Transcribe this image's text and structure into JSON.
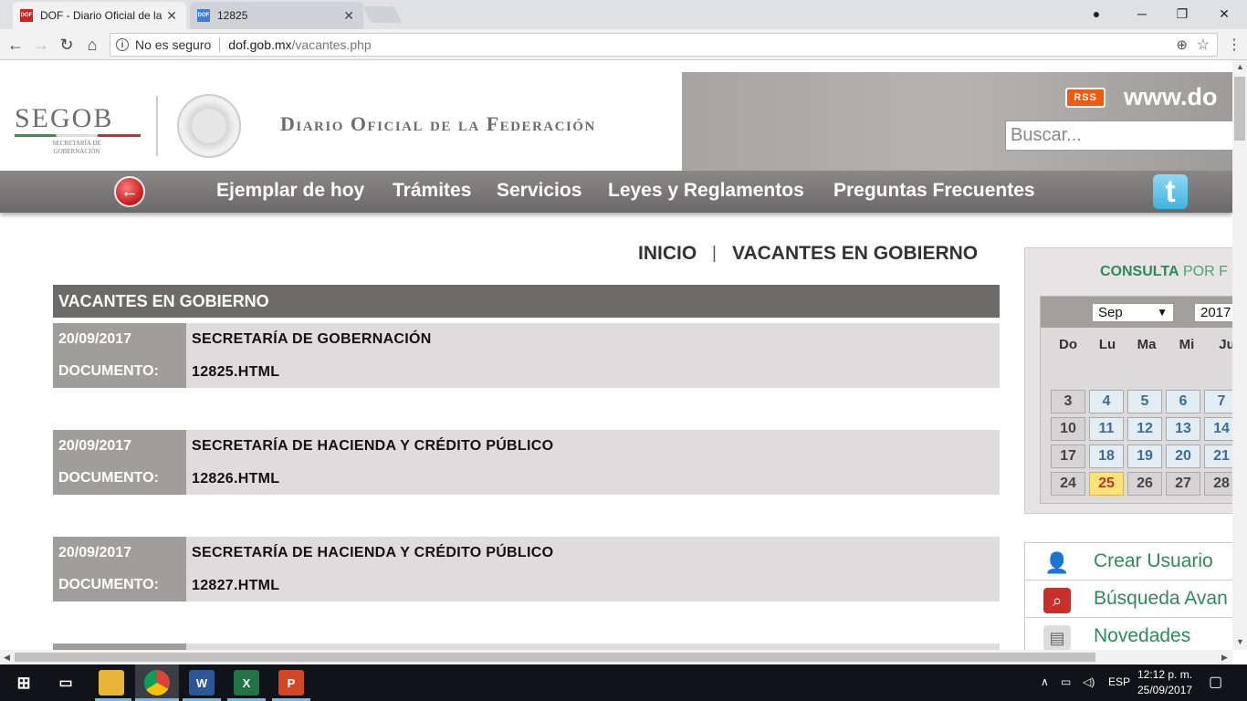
{
  "browser": {
    "tabs": [
      {
        "title": "DOF - Diario Oficial de la",
        "favicon": "DOF",
        "active": true
      },
      {
        "title": "12825",
        "favicon": "DOF",
        "active": false
      }
    ],
    "security_label": "No es seguro",
    "url_host": "dof.gob.mx",
    "url_path": "/vacantes.php"
  },
  "header": {
    "logo_text": "SEGOB",
    "logo_sub": "SECRETARÍA DE GOBERNACIÓN",
    "title": "Diario Oficial de la Federación",
    "rss_label": "RSS",
    "www_text": "www.do",
    "search_placeholder": "Buscar..."
  },
  "nav": {
    "items": [
      "Ejemplar de hoy",
      "Trámites",
      "Servicios",
      "Leyes y Reglamentos",
      "Preguntas Frecuentes"
    ]
  },
  "breadcrumb": {
    "home": "INICIO",
    "separator": "|",
    "current": "VACANTES EN GOBIERNO"
  },
  "list": {
    "header": "VACANTES EN GOBIERNO",
    "doc_label": "DOCUMENTO:",
    "items": [
      {
        "date": "20/09/2017",
        "agency": "SECRETARÍA DE GOBERNACIÓN",
        "document": "12825.HTML"
      },
      {
        "date": "20/09/2017",
        "agency": "SECRETARÍA DE HACIENDA Y CRÉDITO PÚBLICO",
        "document": "12826.HTML"
      },
      {
        "date": "20/09/2017",
        "agency": "SECRETARÍA DE HACIENDA Y CRÉDITO PÚBLICO",
        "document": "12827.HTML"
      }
    ]
  },
  "sidebar": {
    "consulta_bold": "CONSULTA",
    "consulta_rest": "POR F",
    "calendar": {
      "month": "Sep",
      "year": "2017",
      "dow": [
        "Do",
        "Lu",
        "Ma",
        "Mi",
        "Ju"
      ],
      "rows": [
        [
          "3",
          "4",
          "5",
          "6",
          "7"
        ],
        [
          "10",
          "11",
          "12",
          "13",
          "14"
        ],
        [
          "17",
          "18",
          "19",
          "20",
          "21"
        ],
        [
          "24",
          "25",
          "26",
          "27",
          "28"
        ]
      ],
      "today": "25"
    },
    "links": [
      "Crear Usuario",
      "Búsqueda Avan",
      "Novedades"
    ]
  },
  "taskbar": {
    "lang": "ESP",
    "time": "12:12 p. m.",
    "date": "25/09/2017"
  }
}
